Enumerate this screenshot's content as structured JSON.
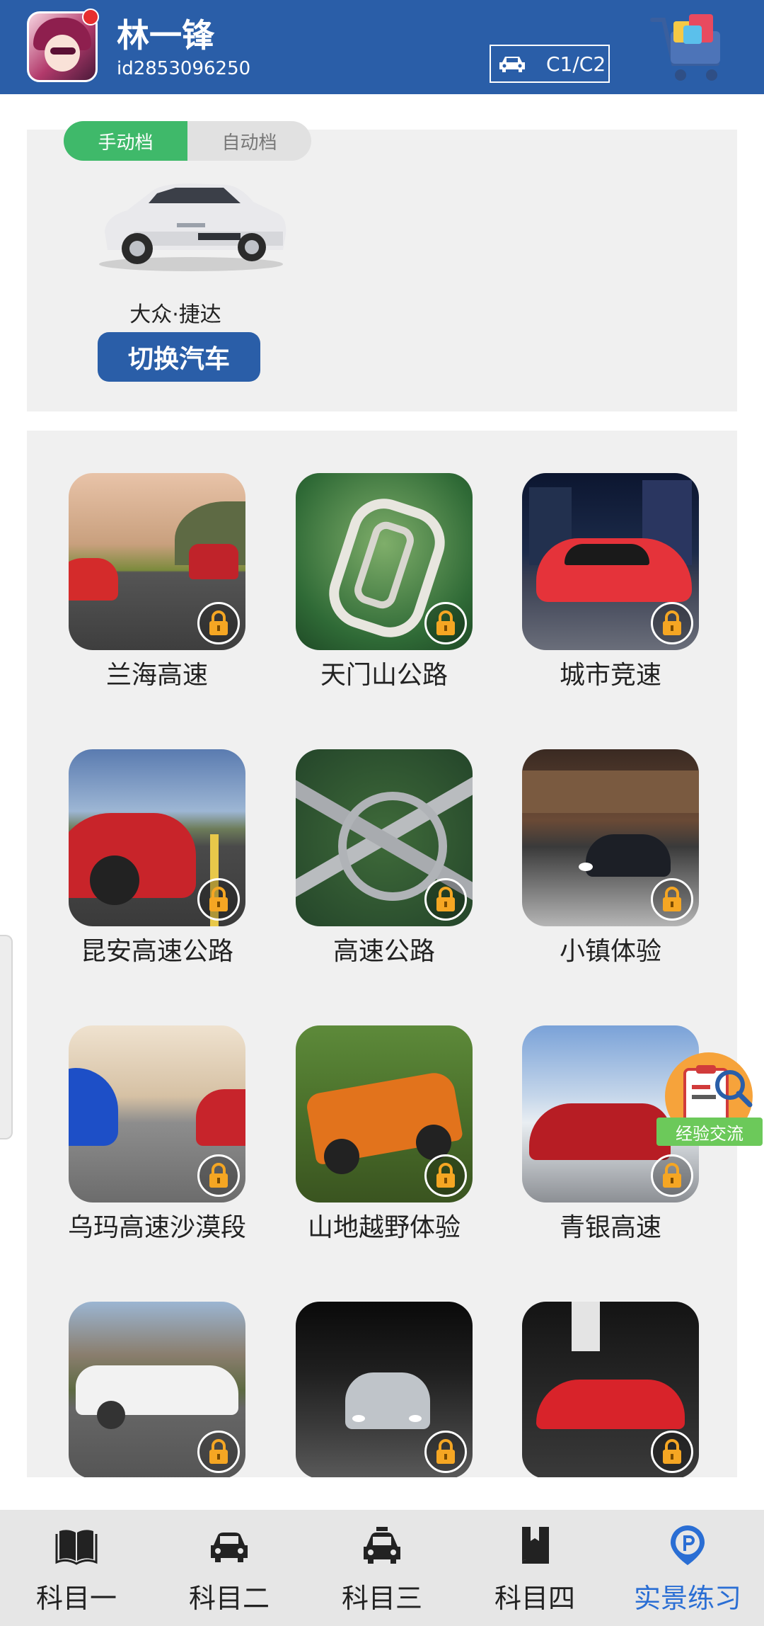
{
  "header": {
    "username": "林一锋",
    "user_id": "id2853096250",
    "license_type": "C1/C2"
  },
  "car_panel": {
    "transmission_tabs": [
      "手动档",
      "自动档"
    ],
    "selected_tab": "手动档",
    "car_name": "大众·捷达",
    "switch_button_label": "切换汽车"
  },
  "levels": [
    {
      "label": "兰海高速",
      "locked": true
    },
    {
      "label": "天门山公路",
      "locked": true
    },
    {
      "label": "城市竞速",
      "locked": true
    },
    {
      "label": "昆安高速公路",
      "locked": true
    },
    {
      "label": "高速公路",
      "locked": true
    },
    {
      "label": "小镇体验",
      "locked": true
    },
    {
      "label": "乌玛高速沙漠段",
      "locked": true
    },
    {
      "label": "山地越野体验",
      "locked": true
    },
    {
      "label": "青银高速",
      "locked": true
    },
    {
      "label": "",
      "locked": true
    },
    {
      "label": "",
      "locked": true
    },
    {
      "label": "",
      "locked": true
    }
  ],
  "experience_badge": {
    "label": "经验交流"
  },
  "bottom_nav": {
    "items": [
      {
        "label": "科目一",
        "icon": "book-open-icon"
      },
      {
        "label": "科目二",
        "icon": "car-icon"
      },
      {
        "label": "科目三",
        "icon": "car-taxi-icon"
      },
      {
        "label": "科目四",
        "icon": "book-icon"
      },
      {
        "label": "实景练习",
        "icon": "parking-pin-icon"
      }
    ],
    "active": "实景练习"
  },
  "colors": {
    "header_bg": "#2a5ea8",
    "active_tab": "#3fb96a",
    "nav_active": "#2a6ed4",
    "lock_badge": "#f5a623"
  }
}
